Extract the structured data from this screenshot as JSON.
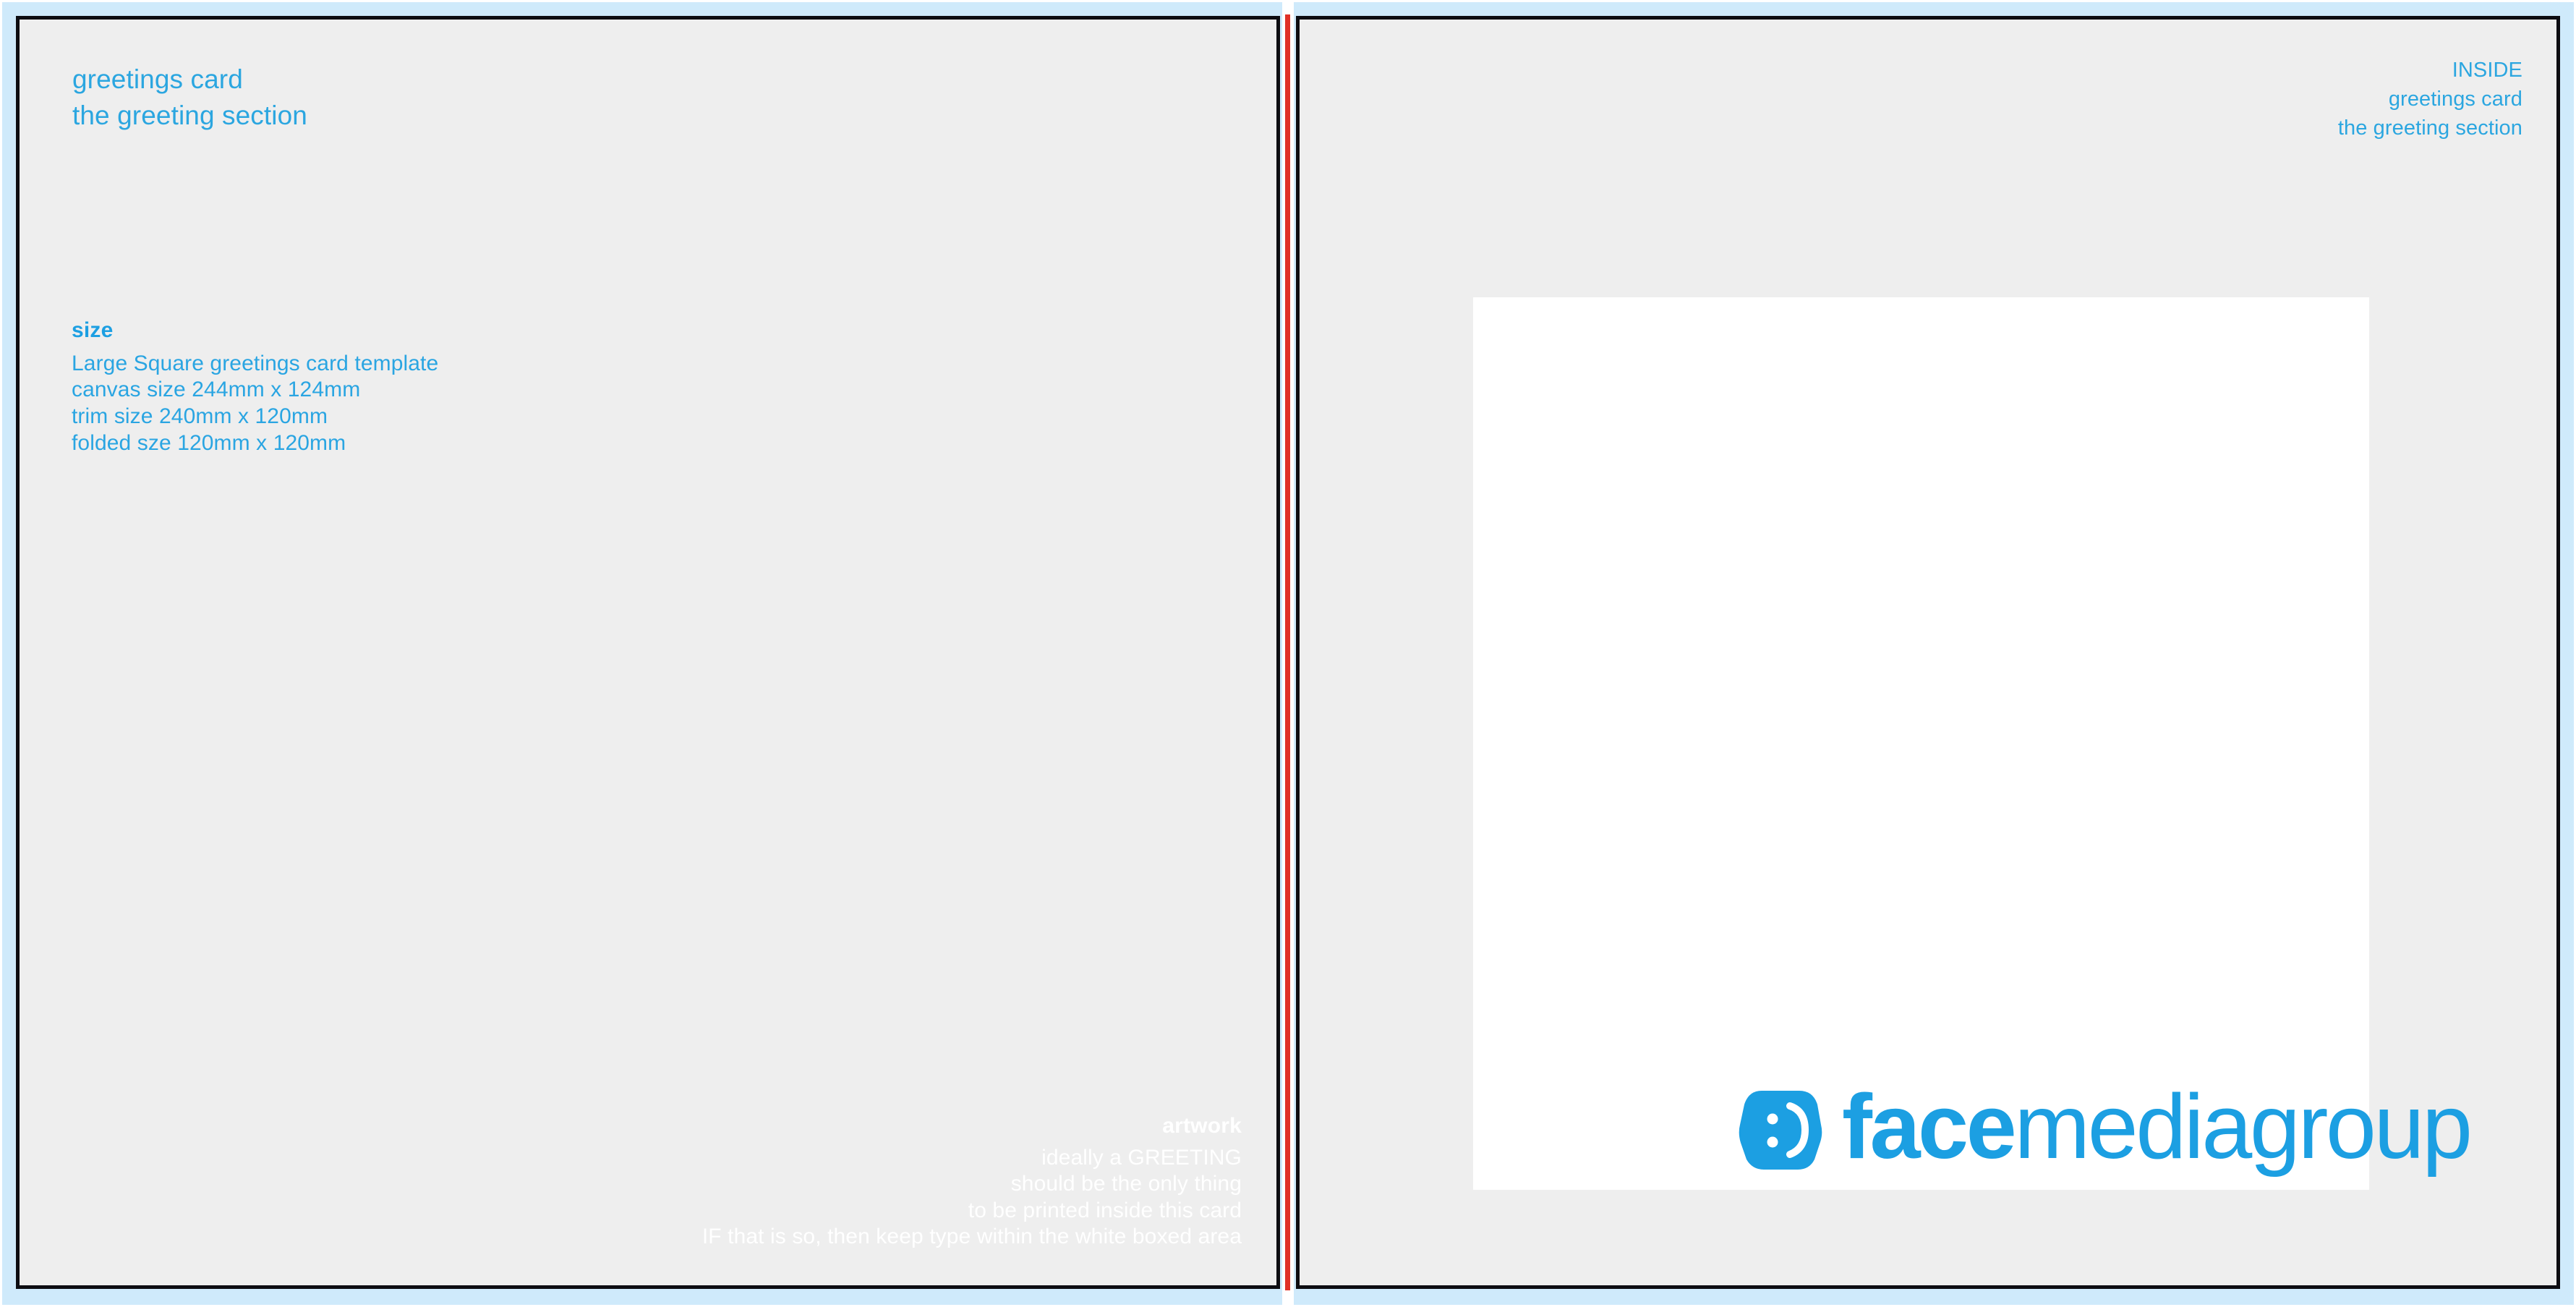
{
  "document": {
    "type": "print-template-artboard",
    "colors": {
      "bleed_blue": "#cfeafb",
      "canvas_grey": "#eeeeee",
      "trim_black": "#0d0d12",
      "fold_red": "#e03127",
      "brand_blue": "#1c9fe2",
      "text_blue": "#2ba6e0",
      "safe_area_white": "#ffffff"
    }
  },
  "left_panel": {
    "heading": {
      "line1": "greetings card",
      "line2": "the greeting section"
    },
    "size": {
      "title": "size",
      "lines": [
        "Large Square greetings card template",
        "canvas size 244mm x 124mm",
        "trim size 240mm x 120mm",
        "folded sze 120mm x 120mm"
      ]
    },
    "artwork_note": {
      "title": "artwork",
      "lines": [
        "ideally a GREETING",
        "should be the only thing",
        "to be printed inside this card",
        "IF that is so, then keep type within the white boxed area"
      ]
    }
  },
  "right_panel": {
    "inside_note": {
      "line1": "INSIDE",
      "line2": "greetings card",
      "line3": "the greeting section"
    },
    "logo": {
      "word_bold": "face",
      "word_light": "mediagroup",
      "mark_name": "smiley-face-mark"
    }
  }
}
